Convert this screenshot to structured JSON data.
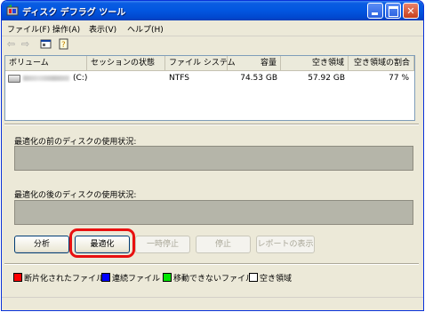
{
  "window": {
    "title": "ディスク デフラグ ツール"
  },
  "menu": [
    {
      "label": "ファイル(F)"
    },
    {
      "label": "操作(A)"
    },
    {
      "label": "表示(V)"
    },
    {
      "label": "ヘルプ(H)"
    }
  ],
  "toolbar": {
    "icons": [
      "back-arrow-icon",
      "forward-arrow-icon",
      "console-icon",
      "help-icon"
    ]
  },
  "volumes": {
    "columns": [
      "ボリューム",
      "セッションの状態",
      "ファイル システム",
      "容量",
      "空き領域",
      "空き領域の割合"
    ],
    "rows": [
      {
        "volume": "(C:)",
        "session": "",
        "filesystem": "NTFS",
        "capacity": "74.53 GB",
        "free": "57.92 GB",
        "percent": "77 %"
      }
    ]
  },
  "before_label": "最適化の前のディスクの使用状況:",
  "after_label": "最適化の後のディスクの使用状況:",
  "buttons": {
    "analyze": "分析",
    "defrag": "最適化",
    "pause": "一時停止",
    "stop": "停止",
    "report": "レポートの表示"
  },
  "legend": [
    {
      "label": "断片化されたファイル",
      "color": "#ff0000"
    },
    {
      "label": "連続ファイル",
      "color": "#0000ff"
    },
    {
      "label": "移動できないファイル",
      "color": "#00e600"
    },
    {
      "label": "空き領域",
      "color": "#ffffff"
    }
  ],
  "colors": {
    "titlebar": "#0256e0",
    "highlight": "#e81010",
    "usage_bar": "#b5b5a9"
  }
}
